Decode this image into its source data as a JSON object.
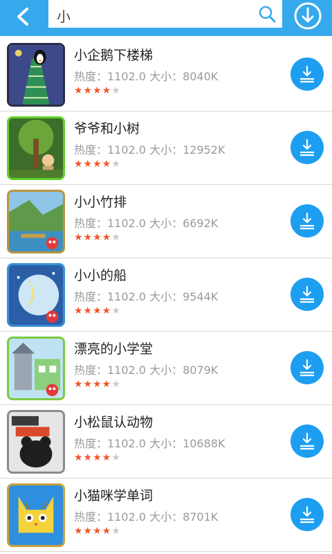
{
  "colors": {
    "accent": "#35a9ec",
    "download_button": "#1e9ef0",
    "star_on": "#f0552a",
    "star_off": "#c9c9c9"
  },
  "header": {
    "search_value": "小",
    "back_icon": "back-arrow-icon",
    "search_icon": "search-icon",
    "download_manager_icon": "download-circle-icon"
  },
  "apps": [
    {
      "title": "小企鹅下楼梯",
      "meta": "热度：1102.0  大小：8040K",
      "stars": "★★★★",
      "stars_empty": "★",
      "rating": 4
    },
    {
      "title": "爷爷和小树",
      "meta": "热度：1102.0  大小：12952K",
      "stars": "★★★★",
      "stars_empty": "★",
      "rating": 4
    },
    {
      "title": "小小竹排",
      "meta": "热度：1102.0  大小：6692K",
      "stars": "★★★★",
      "stars_empty": "★",
      "rating": 4
    },
    {
      "title": "小小的船",
      "meta": "热度：1102.0  大小：9544K",
      "stars": "★★★★",
      "stars_empty": "★",
      "rating": 4
    },
    {
      "title": "漂亮的小学堂",
      "meta": "热度：1102.0  大小：8079K",
      "stars": "★★★★",
      "stars_empty": "★",
      "rating": 4
    },
    {
      "title": "小松鼠认动物",
      "meta": "热度：1102.0  大小：10688K",
      "stars": "★★★★",
      "stars_empty": "★",
      "rating": 4
    },
    {
      "title": "小猫咪学单词",
      "meta": "热度：1102.0  大小：8701K",
      "stars": "★★★★",
      "stars_empty": "★",
      "rating": 4
    }
  ]
}
